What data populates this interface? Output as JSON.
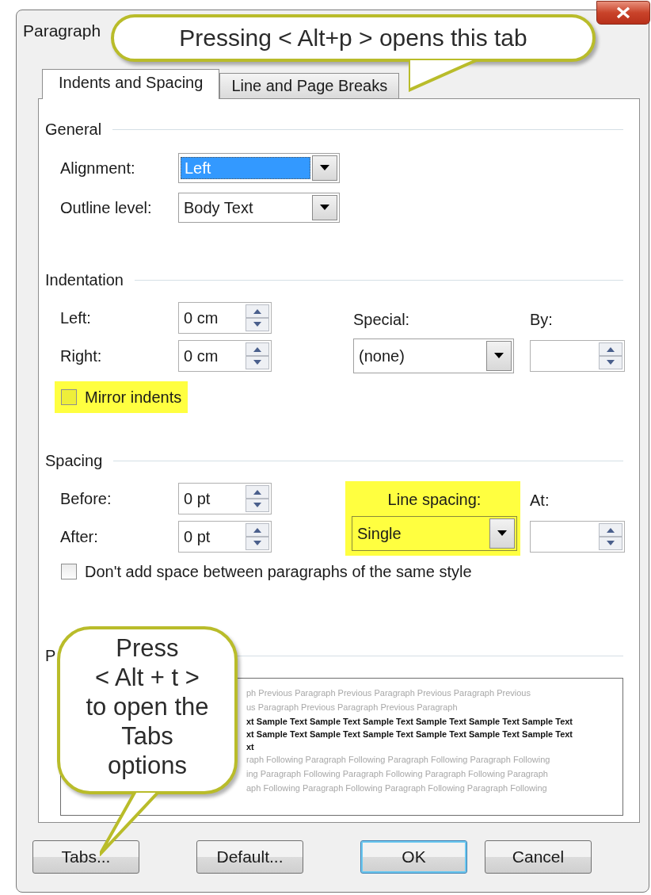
{
  "window": {
    "title": "Paragraph"
  },
  "tabs": [
    {
      "label": "Indents and Spacing",
      "selected": true
    },
    {
      "label": "Line and Page Breaks",
      "selected": false
    }
  ],
  "general": {
    "heading": "General",
    "alignment": {
      "label": "Alignment:",
      "value": "Left",
      "highlighted": true
    },
    "outline_level": {
      "label": "Outline level:",
      "value": "Body Text",
      "highlighted": false
    }
  },
  "indentation": {
    "heading": "Indentation",
    "left": {
      "label": "Left:",
      "value": "0 cm"
    },
    "right": {
      "label": "Right:",
      "value": "0 cm"
    },
    "special": {
      "label": "Special:",
      "value": "(none)",
      "highlighted": false
    },
    "by": {
      "label": "By:"
    },
    "mirror_indents": {
      "label": "Mirror indents",
      "checked": false,
      "highlighted": true
    }
  },
  "spacing": {
    "heading": "Spacing",
    "before": {
      "label": "Before:",
      "value": "0 pt"
    },
    "after": {
      "label": "After:",
      "value": "0 pt"
    },
    "line_spacing": {
      "label": "Line spacing:",
      "value": "Single",
      "highlighted": true
    },
    "at": {
      "label": "At:"
    },
    "dont_add_space": {
      "label": "Don't add space between paragraphs of the same style",
      "checked": false,
      "highlighted": false
    }
  },
  "preview": {
    "heading": "P",
    "lines": [
      {
        "kind": "previous",
        "text": "ph Previous Paragraph Previous Paragraph Previous Paragraph Previous"
      },
      {
        "kind": "previous",
        "text": "us Paragraph Previous Paragraph Previous Paragraph"
      },
      {
        "kind": "sample",
        "text": "xt Sample Text Sample Text Sample Text Sample Text Sample Text Sample Text"
      },
      {
        "kind": "sample",
        "text": "xt Sample Text Sample Text Sample Text Sample Text Sample Text Sample Text"
      },
      {
        "kind": "sample",
        "text": "xt"
      },
      {
        "kind": "following",
        "text": "raph Following Paragraph Following Paragraph Following Paragraph Following"
      },
      {
        "kind": "following",
        "text": "ing Paragraph Following Paragraph Following Paragraph Following Paragraph"
      },
      {
        "kind": "following",
        "text": "aph Following Paragraph Following Paragraph Following Paragraph Following"
      }
    ]
  },
  "buttons": [
    {
      "label": "Tabs...",
      "default": false
    },
    {
      "label": "Default...",
      "default": false
    },
    {
      "label": "OK",
      "default": true
    },
    {
      "label": "Cancel",
      "default": false
    }
  ],
  "callouts": [
    {
      "kind": "top",
      "text": "Pressing < Alt+p > opens this tab"
    },
    {
      "kind": "bottom",
      "text": "Press\n< Alt + t >\nto open the\nTabs\noptions"
    }
  ]
}
